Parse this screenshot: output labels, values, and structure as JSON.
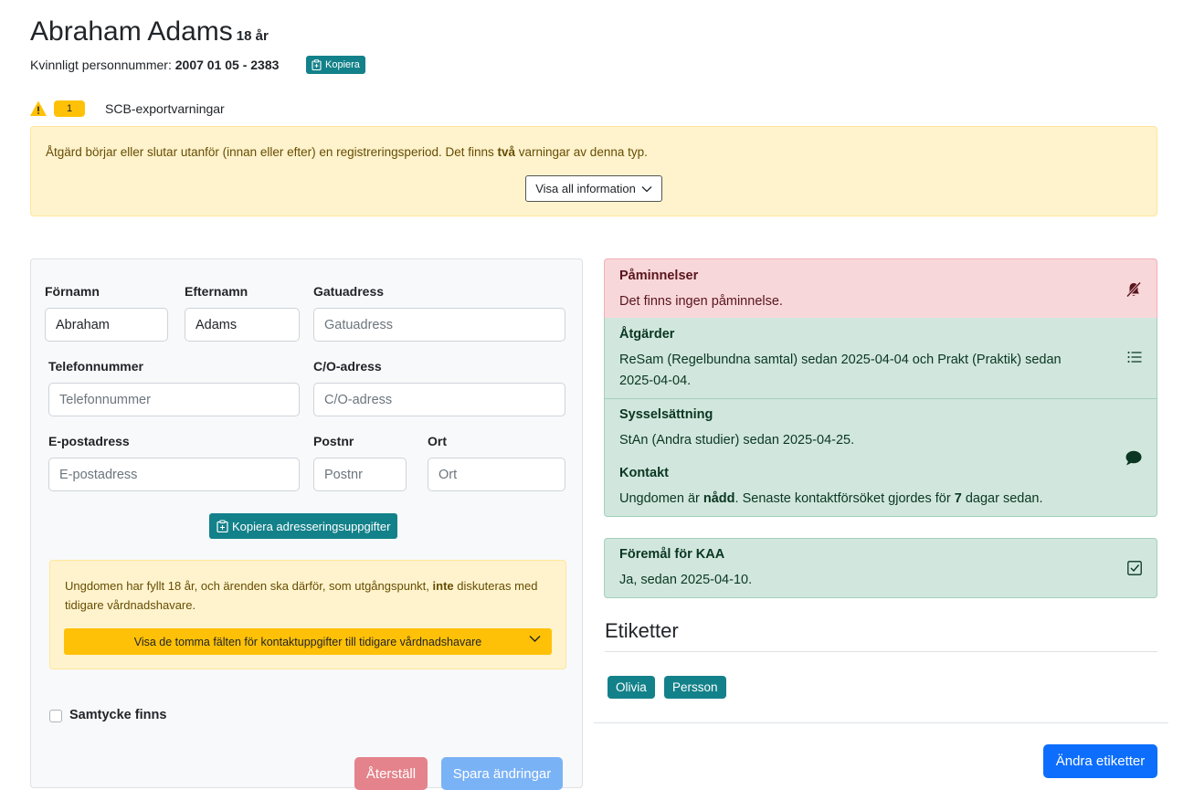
{
  "header": {
    "name": "Abraham Adams",
    "age": "18 år",
    "pnr_label": "Kvinnligt personnummer:",
    "pnr_value": "2007 01 05 - 2383",
    "copy_label": "Kopiera"
  },
  "warnings": {
    "count": "1",
    "label": "SCB-exportvarningar",
    "text_before": "Åtgärd börjar eller slutar utanför (innan eller efter) en registreringsperiod. Det finns ",
    "text_bold": "två",
    "text_after": " varningar av denna typ.",
    "show_all_label": "Visa all information"
  },
  "form": {
    "fornamn_label": "Förnamn",
    "fornamn_value": "Abraham",
    "efternamn_label": "Efternamn",
    "efternamn_value": "Adams",
    "gatuadress_label": "Gatuadress",
    "gatuadress_placeholder": "Gatuadress",
    "telefon_label": "Telefonnummer",
    "telefon_placeholder": "Telefonnummer",
    "co_label": "C/O-adress",
    "co_placeholder": "C/O-adress",
    "epost_label": "E-postadress",
    "epost_placeholder": "E-postadress",
    "postnr_label": "Postnr",
    "postnr_placeholder": "Postnr",
    "ort_label": "Ort",
    "ort_placeholder": "Ort",
    "copy_address_label": "Kopiera adresseringsuppgifter",
    "guardian_text_before": "Ungdomen har fyllt 18 år, och ärenden ska därför, som utgångspunkt, ",
    "guardian_text_bold": "inte",
    "guardian_text_after": " diskuteras med tidigare vårdnadshavare.",
    "guardian_button": "Visa de tomma fälten för kontaktuppgifter till tidigare vårdnadshavare",
    "consent_label": "Samtycke finns",
    "reset_label": "Återställ",
    "save_label": "Spara ändringar"
  },
  "cards": {
    "reminders_title": "Påminnelser",
    "reminders_text": "Det finns ingen påminnelse.",
    "actions_title": "Åtgärder",
    "actions_text": "ReSam (Regelbundna samtal) sedan 2025-04-04 och Prakt (Praktik) sedan 2025-04-04.",
    "employment_title": "Sysselsättning",
    "employment_text": "StAn (Andra studier) sedan 2025-04-25.",
    "contact_title": "Kontakt",
    "contact_text_before": "Ungdomen är ",
    "contact_text_bold": "nådd",
    "contact_text_middle": ". Senaste kontaktförsöket gjordes för ",
    "contact_text_days": "7",
    "contact_text_after": " dagar sedan.",
    "kaa_title": "Föremål för KAA",
    "kaa_text": "Ja, sedan 2025-04-10."
  },
  "tags": {
    "heading": "Etiketter",
    "items": [
      "Olivia",
      "Persson"
    ],
    "edit_label": "Ändra etiketter"
  },
  "colors": {
    "teal": "#13818a",
    "warning": "#ffc107",
    "danger_bg": "#f8d7da",
    "success_bg": "#d1e7dd",
    "primary": "#0d6efd"
  },
  "icons": [
    "clipboard-icon",
    "warning-triangle-icon",
    "chevron-down-icon",
    "bell-slash-icon",
    "list-icon",
    "chat-icon",
    "check-square-icon"
  ]
}
